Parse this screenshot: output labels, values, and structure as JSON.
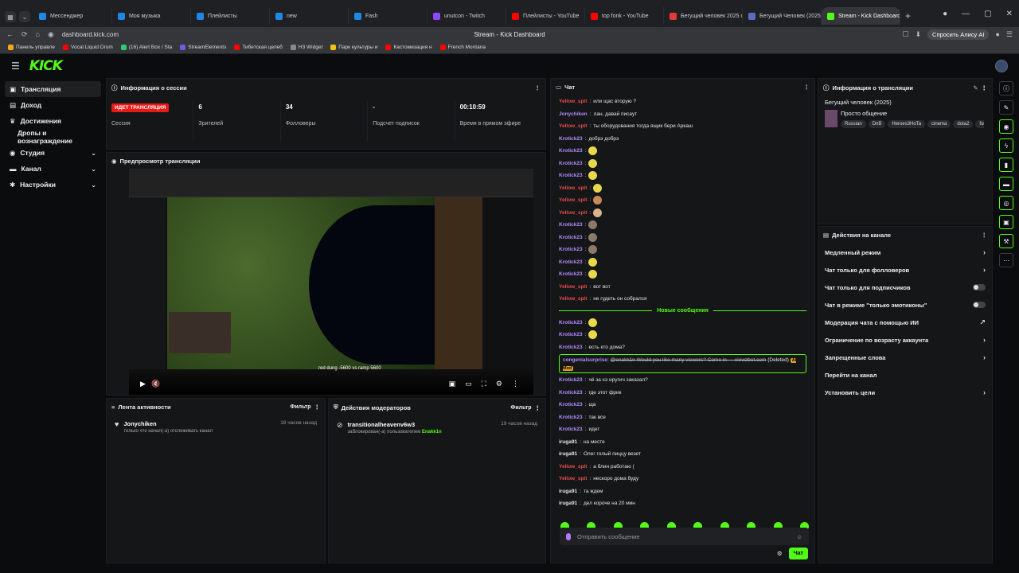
{
  "browser": {
    "tabs": [
      {
        "label": "Мессенджер",
        "color": "#1e88e5"
      },
      {
        "label": "Моя музыка",
        "color": "#1e88e5"
      },
      {
        "label": "Плейлисты",
        "color": "#1e88e5"
      },
      {
        "label": "new",
        "color": "#1e88e5"
      },
      {
        "label": "Fash",
        "color": "#1e88e5"
      },
      {
        "label": "unutcon - Twitch",
        "color": "#9146ff"
      },
      {
        "label": "Плейлисты - YouTube",
        "color": "#ff0000"
      },
      {
        "label": "top fonk - YouTube",
        "color": "#ff0000"
      },
      {
        "label": "Бегущий человек 2025 ф",
        "color": "#e53935"
      },
      {
        "label": "Бегущий Человек (2025)",
        "color": "#5c6bc0"
      },
      {
        "label": "Stream - Kick Dashboard",
        "color": "#53fc18"
      }
    ],
    "url": "dashboard.kick.com",
    "page_title": "Stream - Kick Dashboard",
    "alice_label": "Спросить Алису AI",
    "bookmarks": [
      {
        "label": "Панель управле",
        "color": "#f5a623"
      },
      {
        "label": "Vocal Liquid Drum",
        "color": "#ff0000"
      },
      {
        "label": "(16) Alert Box / Sta",
        "color": "#2ecc71"
      },
      {
        "label": "StreamElements",
        "color": "#6c5ce7"
      },
      {
        "label": "Тибетская целеб",
        "color": "#ff0000"
      },
      {
        "label": "H3 Widget",
        "color": "#888888"
      },
      {
        "label": "Парк культуры и",
        "color": "#f1c40f"
      },
      {
        "label": "Кастомизация н",
        "color": "#ff0000"
      },
      {
        "label": "French Montana",
        "color": "#ff0000"
      }
    ]
  },
  "sidebar": {
    "items": [
      {
        "label": "Трансляция",
        "icon": "video-icon",
        "glyph": "▣"
      },
      {
        "label": "Доход",
        "icon": "dollar-icon",
        "glyph": "▤"
      },
      {
        "label": "Достижения",
        "icon": "trophy-icon",
        "glyph": "♛"
      },
      {
        "label": "Дропы и вознаграждение",
        "icon": "",
        "glyph": ""
      },
      {
        "label": "Студия",
        "icon": "studio-icon",
        "glyph": "◉"
      },
      {
        "label": "Канал",
        "icon": "channel-icon",
        "glyph": "▬"
      },
      {
        "label": "Настройки",
        "icon": "gear-icon",
        "glyph": "✱"
      }
    ]
  },
  "session": {
    "title": "Информация о сессии",
    "live_badge": "ИДЕТ ТРАНСЛЯЦИЯ",
    "stats": [
      {
        "label": "Сессия",
        "value": ""
      },
      {
        "label": "Зрителей",
        "value": "6"
      },
      {
        "label": "Фолловеры",
        "value": "34"
      },
      {
        "label": "Подсчет подписок",
        "value": "-"
      },
      {
        "label": "Время в прямом эфире",
        "value": "00:10:59"
      }
    ]
  },
  "preview": {
    "title": "Предпросмотр трансляции",
    "score_text": "red dung -5600 vs ramp 5600"
  },
  "activity": {
    "title": "Лента активности",
    "filter": "Фильтр",
    "items": [
      {
        "name": "Jonychiken",
        "text": "только что начал(-а) отслеживать канал",
        "time": "18 часов назад"
      }
    ]
  },
  "mod_actions": {
    "title": "Действия модераторов",
    "filter": "Фильтр",
    "items": [
      {
        "name": "transitionalheavenv6w3",
        "text": "заблокирован(-а) пользователем",
        "target": "Enakk1n",
        "time": "19 часов назад"
      }
    ]
  },
  "chat": {
    "title": "Чат",
    "messages_before": [
      {
        "user": "Yellow_spit",
        "color": "#e84c4c",
        "text": "или щас вторую ?",
        "emote": ""
      },
      {
        "user": "Jonychiken",
        "color": "#b48cff",
        "text": "лан, давай писаут",
        "emote": ""
      },
      {
        "user": "Yellow_spit",
        "color": "#e84c4c",
        "text": "ты оборудования тогда ящик бери Аркаш",
        "emote": ""
      },
      {
        "user": "Krotick23",
        "color": "#b48cff",
        "text": "добрэ добрэ",
        "emote": ""
      },
      {
        "user": "Krotick23",
        "color": "#b48cff",
        "text": "",
        "emote": "#e8d84a"
      },
      {
        "user": "Krotick23",
        "color": "#b48cff",
        "text": "",
        "emote": "#e8d84a"
      },
      {
        "user": "Krotick23",
        "color": "#b48cff",
        "text": "",
        "emote": "#e8d84a"
      },
      {
        "user": "Yellow_spit",
        "color": "#e84c4c",
        "text": "",
        "emote": "#e8d84a"
      },
      {
        "user": "Yellow_spit",
        "color": "#e84c4c",
        "text": "",
        "emote": "#c98a5a"
      },
      {
        "user": "Yellow_spit",
        "color": "#e84c4c",
        "text": "",
        "emote": "#d9b48a"
      },
      {
        "user": "Krotick23",
        "color": "#b48cff",
        "text": "",
        "emote": "#8a7a6a"
      },
      {
        "user": "Krotick23",
        "color": "#b48cff",
        "text": "",
        "emote": "#8a7a6a"
      },
      {
        "user": "Krotick23",
        "color": "#b48cff",
        "text": "",
        "emote": "#8a7a6a"
      },
      {
        "user": "Krotick23",
        "color": "#b48cff",
        "text": "",
        "emote": "#e8d84a"
      },
      {
        "user": "Krotick23",
        "color": "#b48cff",
        "text": "",
        "emote": "#e8d84a"
      },
      {
        "user": "Yellow_spit",
        "color": "#e84c4c",
        "text": "вот вот",
        "emote": ""
      },
      {
        "user": "Yellow_spit",
        "color": "#e84c4c",
        "text": "не гудеть он собрался",
        "emote": ""
      }
    ],
    "new_messages_label": "Новые сообщения",
    "messages_after_a": [
      {
        "user": "Krotick23",
        "color": "#b48cff",
        "text": "",
        "emote": "#e8d84a"
      },
      {
        "user": "Krotick23",
        "color": "#b48cff",
        "text": "",
        "emote": "#e8d84a"
      },
      {
        "user": "Krotick23",
        "color": "#b48cff",
        "text": "есть кто дома?",
        "emote": ""
      }
    ],
    "flagged": {
      "user": "congenialsurprise",
      "text": "@enakk1n Would you like many viewers? Come in — viewzbot.com",
      "deleted": "(Deleted)",
      "tag": "AI Mod"
    },
    "messages_after_b": [
      {
        "user": "Krotick23",
        "color": "#b48cff",
        "text": "чё за хэ иругич заказал?",
        "emote": ""
      },
      {
        "user": "Krotick23",
        "color": "#b48cff",
        "text": "где этот фрик",
        "emote": ""
      },
      {
        "user": "Krotick23",
        "color": "#b48cff",
        "text": "ща",
        "emote": ""
      },
      {
        "user": "Krotick23",
        "color": "#b48cff",
        "text": "так все",
        "emote": ""
      },
      {
        "user": "Krotick23",
        "color": "#b48cff",
        "text": "идет",
        "emote": ""
      },
      {
        "user": "iruga91",
        "color": "#e6e6e6",
        "text": "на месте",
        "emote": ""
      },
      {
        "user": "iruga91",
        "color": "#e6e6e6",
        "text": "Олег голый пиццу везет",
        "emote": ""
      },
      {
        "user": "Yellow_spit",
        "color": "#e84c4c",
        "text": "а блин работаю (",
        "emote": ""
      },
      {
        "user": "Yellow_spit",
        "color": "#e84c4c",
        "text": "нескоро дома буду",
        "emote": ""
      },
      {
        "user": "iruga91",
        "color": "#e6e6e6",
        "text": "та ждем",
        "emote": ""
      },
      {
        "user": "iruga91",
        "color": "#e6e6e6",
        "text": "дел короче на 20 мин",
        "emote": ""
      }
    ],
    "input_placeholder": "Отправить сообщение",
    "send_label": "Чат"
  },
  "stream_info": {
    "title": "Информация о трансляции",
    "stream_title": "Бегущий человек (2025)",
    "category": "Просто общение",
    "tags": [
      "Russian",
      "DnB",
      "Heroes3HoTa",
      "cinema",
      "dota2",
      "fom"
    ]
  },
  "channel_actions": {
    "title": "Действия на канале",
    "items": [
      {
        "label": "Медленный режим",
        "control": "chevron"
      },
      {
        "label": "Чат только для фолловеров",
        "control": "chevron"
      },
      {
        "label": "Чат только для подписчиков",
        "control": "toggle"
      },
      {
        "label": "Чат в режиме \"только эмотиконы\"",
        "control": "toggle"
      },
      {
        "label": "Модерация чата с помощью ИИ",
        "control": "external"
      },
      {
        "label": "Ограничение по возрасту аккаунта",
        "control": "chevron"
      },
      {
        "label": "Запрещенные слова",
        "control": "chevron"
      },
      {
        "label": "Перейти на канал",
        "control": "none"
      },
      {
        "label": "Установить цели",
        "control": "chevron"
      }
    ]
  },
  "brand": {
    "logo": "KICK",
    "accent": "#53fc18"
  }
}
